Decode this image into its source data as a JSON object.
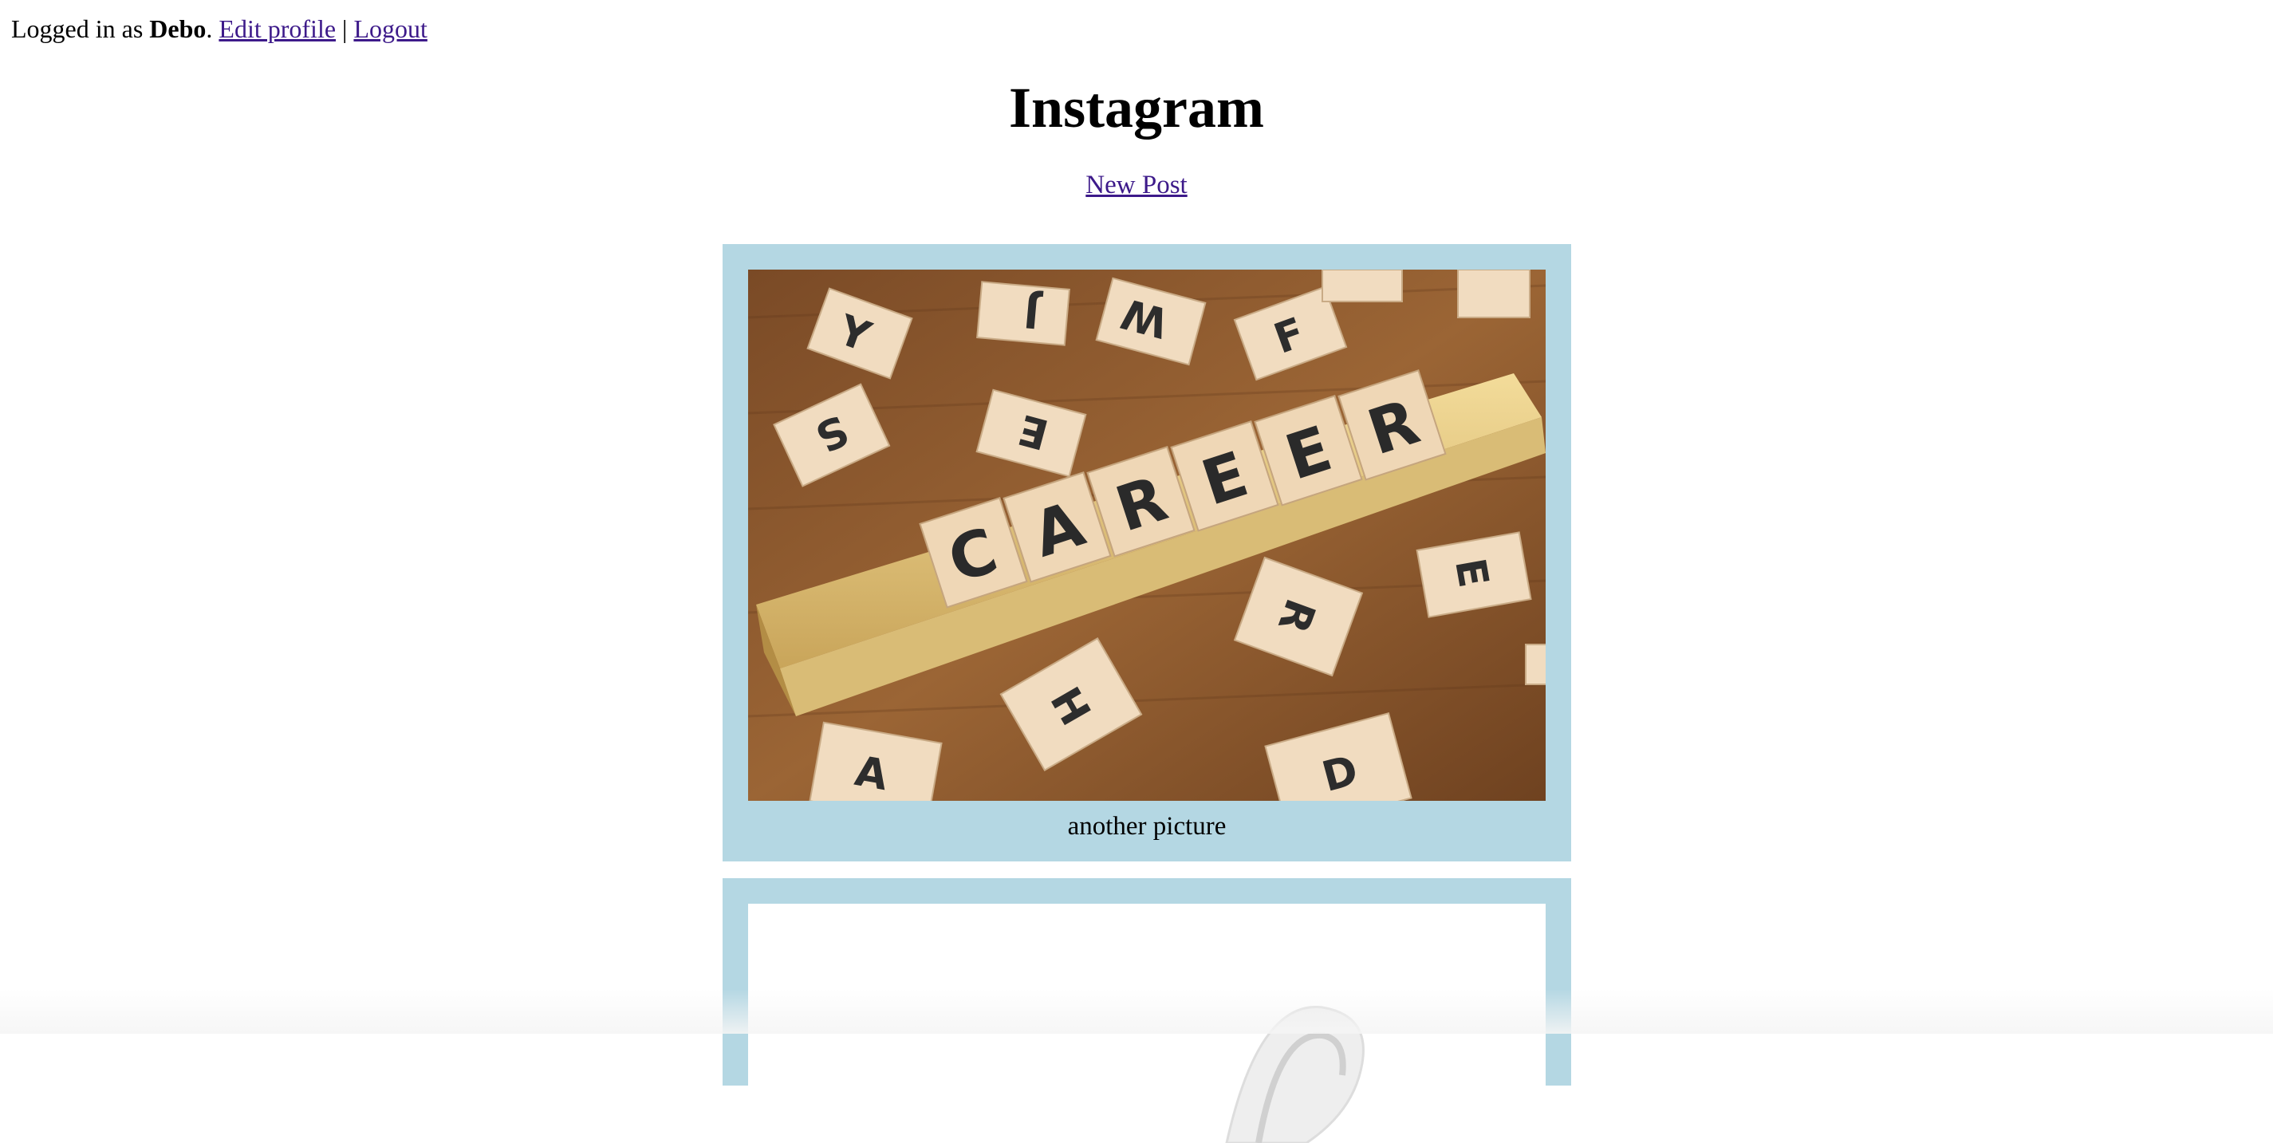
{
  "userbar": {
    "prefix": "Logged in as ",
    "username": "Debo",
    "suffix": ".",
    "edit_profile": "Edit profile",
    "separator": " | ",
    "logout": "Logout"
  },
  "header": {
    "title": "Instagram",
    "new_post": "New Post"
  },
  "posts": [
    {
      "image": "scrabble-career-photo",
      "caption": "another picture"
    },
    {
      "image": "white-object-photo",
      "caption": ""
    }
  ],
  "colors": {
    "post_background": "#b4d7e3",
    "link": "#3d1a8a"
  }
}
